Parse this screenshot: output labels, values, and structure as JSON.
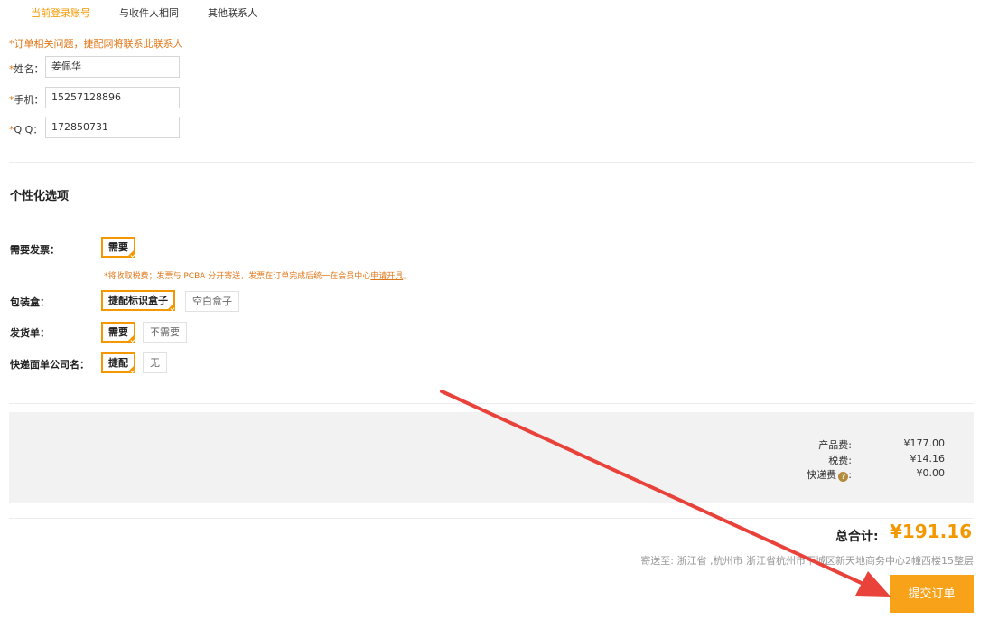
{
  "contact_tabs": [
    "当前登录账号",
    "与收件人相同",
    "其他联系人"
  ],
  "contact_note": "*订单相关问题，捷配网将联系此联系人",
  "form": {
    "name": {
      "star": "*",
      "label": "姓名：",
      "value": "姜佩华"
    },
    "phone": {
      "star": "*",
      "label": "手机：",
      "value": "15257128896"
    },
    "qq": {
      "star": "*",
      "label": "Q Q：",
      "value": "172850731"
    }
  },
  "section_title": "个性化选项",
  "options": {
    "invoice": {
      "label": "需要发票：",
      "choices": [
        "需要"
      ],
      "selected": "需要"
    },
    "invoice_note": {
      "prefix": "*将收取税费；发票与 PCBA 分开寄送，发票在订单完成后统一在会员中心",
      "link": "申请开具",
      "suffix": "。"
    },
    "box": {
      "label": "包装盒：",
      "choices": [
        "捷配标识盒子",
        "空白盒子"
      ],
      "selected": "捷配标识盒子"
    },
    "delivery_note": {
      "label": "发货单：",
      "choices": [
        "需要",
        "不需要"
      ],
      "selected": "需要"
    },
    "courier_name": {
      "label": "快递面单公司名：",
      "choices": [
        "捷配",
        "无"
      ],
      "selected": "捷配"
    }
  },
  "fees": {
    "product": {
      "label": "产品费:",
      "value": "¥177.00"
    },
    "tax": {
      "label": "税费:",
      "value": "¥14.16"
    },
    "shipping": {
      "label": "快递费",
      "icon": "question-icon",
      "suffix": ":",
      "value": "¥0.00"
    }
  },
  "total": {
    "label": "总合计:",
    "value": "¥191.16"
  },
  "address": "寄送至: 浙江省 ,杭州市 浙江省杭州市下城区新天地商务中心2幢西楼15整层",
  "submit_label": "提交订单",
  "colors": {
    "accent": "#f39800",
    "note": "#e0781a",
    "annotation_arrow": "#e8423a"
  }
}
